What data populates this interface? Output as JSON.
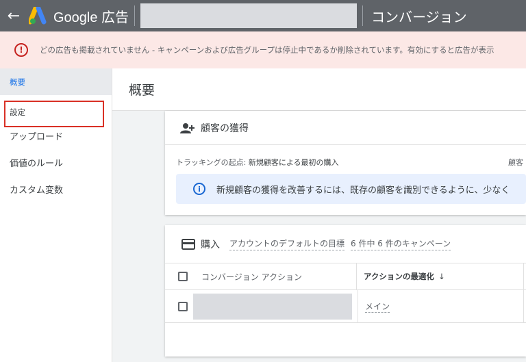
{
  "topbar": {
    "back_icon": "arrow-left-icon",
    "brand": "Google 広告",
    "page_name": "コンバージョン"
  },
  "alert": {
    "icon": "error-circle-icon",
    "text": "どの広告も掲載されていません - キャンペーンおよび広告グループは停止中であるか削除されています。有効にすると広告が表示"
  },
  "sidebar": {
    "items": [
      {
        "label": "概要"
      },
      {
        "label": "設定"
      },
      {
        "label": "アップロード"
      },
      {
        "label": "価値のルール"
      },
      {
        "label": "カスタム変数"
      }
    ]
  },
  "main": {
    "title": "概要"
  },
  "acquisition_card": {
    "icon": "person-add-icon",
    "title": "顧客の獲得",
    "tracking_label": "トラッキングの起点: ",
    "tracking_value": "新規顧客による最初の購入",
    "tracking_right": "顧客",
    "info_icon": "info-icon",
    "info_text": "新規顧客の獲得を改善するには、既存の顧客を識別できるように、少なく"
  },
  "purchase_card": {
    "icon": "card-icon",
    "title": "購入",
    "default_goal_link": "アカウントのデフォルトの目標",
    "campaign_link": "6 件中 6 件のキャンペーン",
    "columns": {
      "conversion_action": "コンバージョン アクション",
      "optimization": "アクションの最適化",
      "sort_arrow": "↓"
    },
    "rows": [
      {
        "optimization": "メイン"
      }
    ]
  },
  "colors": {
    "topbar": "#5f6368",
    "alert_bg": "#fce8e6",
    "alert_icon": "#c5221f",
    "highlight_border": "#d93025",
    "info_bg": "#e8f0fe",
    "active_nav": "#1a73e8"
  }
}
